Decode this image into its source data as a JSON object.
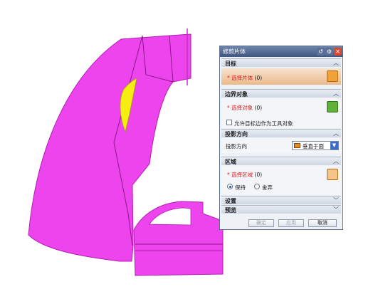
{
  "dialog": {
    "title": "修剪片体",
    "sections": {
      "target": {
        "header": "目标",
        "select_label": "* 选择片体",
        "select_count": "(0)"
      },
      "boundary": {
        "header": "边界对象",
        "select_label": "* 选择对象",
        "select_count": "(0)",
        "checkbox_label": "允许目标边作为工具对象",
        "checkbox_checked": false
      },
      "projection": {
        "header": "投影方向",
        "field_label": "投影方向",
        "dropdown_value": "垂直于面"
      },
      "region": {
        "header": "区域",
        "select_label": "* 选择区域",
        "select_count": "(0)",
        "radio_keep": "保持",
        "radio_discard": "舍弃",
        "selected_radio": "保持"
      },
      "settings": {
        "header": "设置"
      },
      "preview": {
        "header": "预览"
      }
    },
    "buttons": {
      "ok": "确定",
      "apply": "应用",
      "cancel": "取消"
    }
  },
  "colors": {
    "surface": "#ee44ee",
    "highlight": "#f5ee10",
    "titlebar": "#4a5f86",
    "selection_highlight": "#efc49a"
  }
}
